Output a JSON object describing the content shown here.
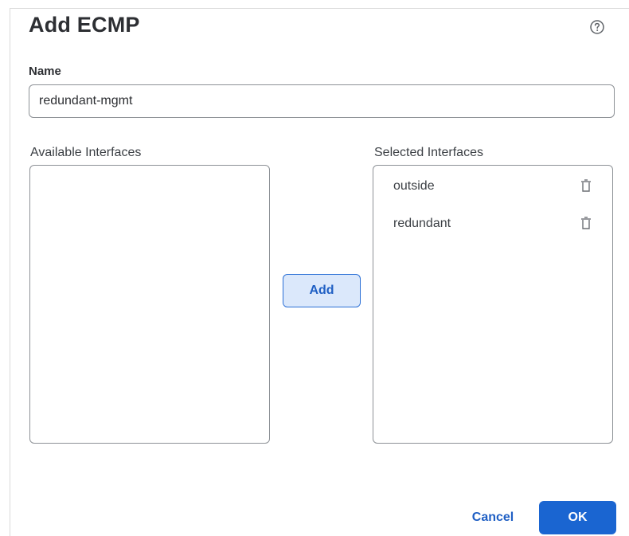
{
  "dialog": {
    "title": "Add ECMP",
    "help_icon": "question-circle-icon"
  },
  "name_field": {
    "label": "Name",
    "value": "redundant-mgmt"
  },
  "available_interfaces": {
    "label": "Available Interfaces",
    "items": []
  },
  "selected_interfaces": {
    "label": "Selected Interfaces",
    "items": [
      {
        "label": "outside",
        "icon": "trash-icon"
      },
      {
        "label": "redundant",
        "icon": "trash-icon"
      }
    ]
  },
  "buttons": {
    "add": "Add",
    "cancel": "Cancel",
    "ok": "OK"
  },
  "colors": {
    "primary": "#1a65d1",
    "add_button_bg": "#dbe8fb"
  }
}
